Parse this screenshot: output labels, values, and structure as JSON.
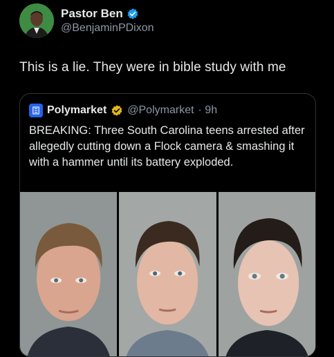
{
  "author": {
    "name": "Pastor Ben",
    "handle": "@BenjaminPDixon"
  },
  "tweet": {
    "text": "This is a lie. They were in bible study with me"
  },
  "quote": {
    "name": "Polymarket",
    "handle": "@Polymarket",
    "time": "· 9h",
    "text": "BREAKING: Three South Carolina teens arrested after allegedly cutting down a Flock camera & smashing it with a hammer until its battery exploded."
  },
  "colors": {
    "background": "#000000",
    "verified_blue": "#1d9bf0",
    "verified_gold": "#e2b719",
    "polymarket_blue": "#2563eb"
  },
  "icons": {
    "author_badge": "verified-blue-icon",
    "quote_badge": "verified-gold-icon",
    "quote_logo": "polymarket-logo-icon"
  }
}
